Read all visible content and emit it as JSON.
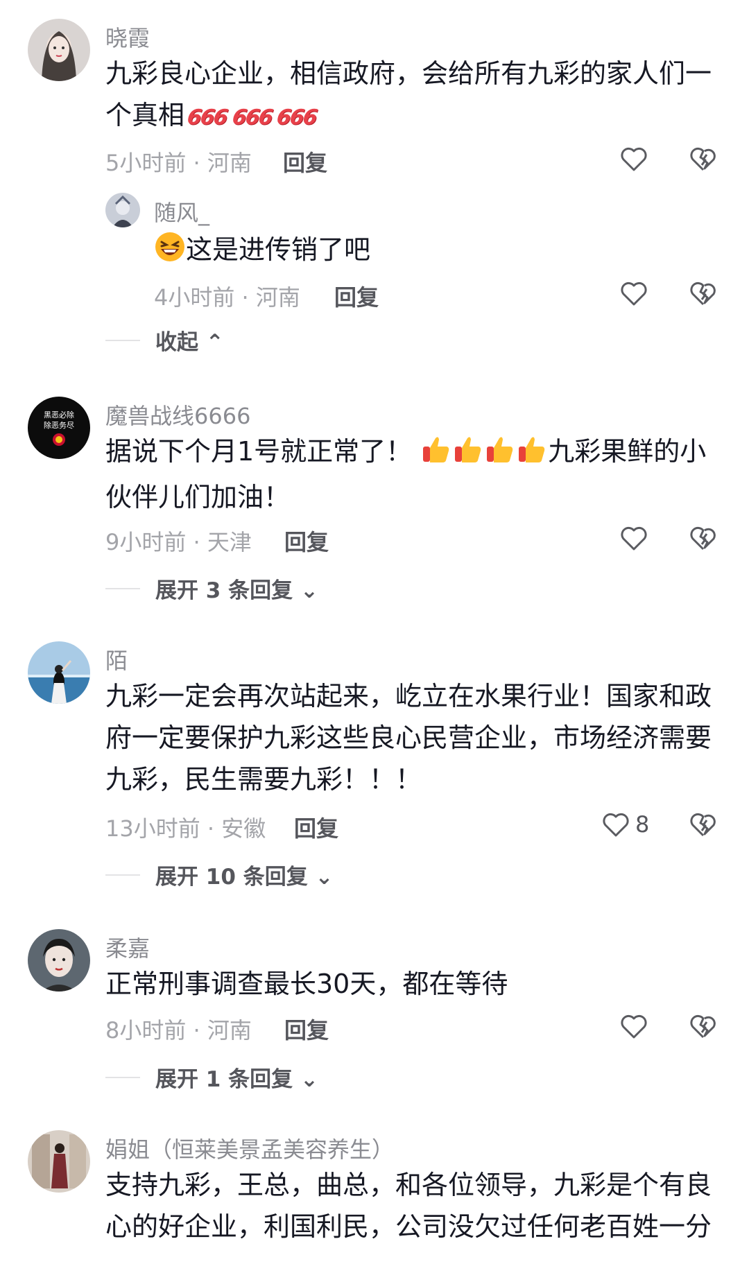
{
  "comments": [
    {
      "user": "晓霞",
      "text_before": "九彩良心企业，相信政府，会给所有九彩的家人们一个真相",
      "badges": [
        "666",
        "666",
        "666"
      ],
      "meta": "5小时前 · 河南",
      "reply_label": "回复",
      "replies": [
        {
          "user": "随风_",
          "text": "这是进传销了吧",
          "emoji": "laughing-face",
          "meta": "4小时前 · 河南",
          "reply_label": "回复"
        }
      ],
      "collapse_label": "收起"
    },
    {
      "user": "魔兽战线6666",
      "avatar_text": "黑恶必除 除恶务尽",
      "text_before": "据说下个月1号就正常了！",
      "emoji": "thumbs-up x4",
      "text_after": "九彩果鲜的小伙伴儿们加油！",
      "meta": "9小时前 · 天津",
      "reply_label": "回复",
      "expand_label": "展开 3 条回复"
    },
    {
      "user": "陌",
      "text": "九彩一定会再次站起来，屹立在水果行业！国家和政府一定要保护九彩这些良心民营企业，市场经济需要九彩，民生需要九彩！！！",
      "meta": "13小时前 · 安徽",
      "reply_label": "回复",
      "likes": "8",
      "expand_label": "展开 10 条回复"
    },
    {
      "user": "柔嘉",
      "text": "正常刑事调查最长30天，都在等待",
      "meta": "8小时前 · 河南",
      "reply_label": "回复",
      "expand_label": "展开 1 条回复"
    },
    {
      "user": "娟姐（恒莱美景孟美容养生）",
      "text": "支持九彩，王总，曲总，和各位领导，九彩是个有良心的好企业，利国利民，公司没欠过任何老百姓一分"
    }
  ],
  "icons": {
    "like": "heart-outline-icon",
    "dislike": "broken-heart-icon",
    "chevron_up": "chevron-up-icon",
    "chevron_down": "chevron-down-icon"
  }
}
